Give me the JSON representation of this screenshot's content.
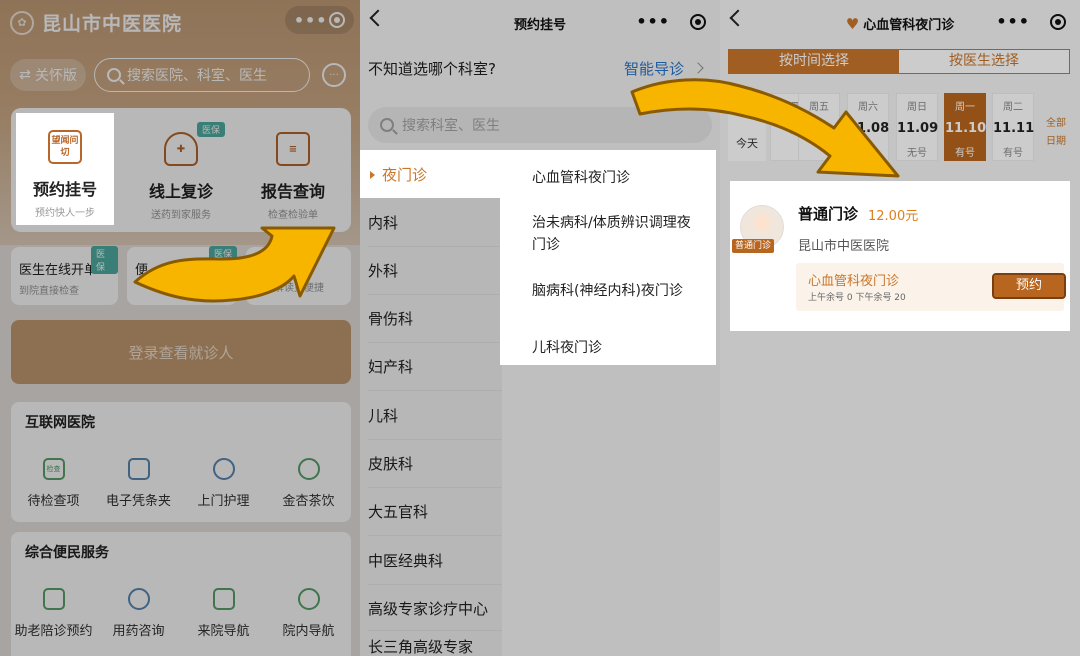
{
  "panel1": {
    "app_title": "昆山市中医医院",
    "care_mode": "关怀版",
    "search_placeholder": "搜索医院、科室、医生",
    "services": [
      {
        "name": "预约挂号",
        "sub": "预约快人一步",
        "icon_text": "望闻问切"
      },
      {
        "name": "线上复诊",
        "sub": "送药到家服务",
        "badge": "医保"
      },
      {
        "name": "报告查询",
        "sub": "检查检验单"
      }
    ],
    "row2": [
      {
        "title": "医生在线开单",
        "sub": "到院直接检查",
        "badge": "医保"
      },
      {
        "title": "便",
        "sub": "",
        "badge": "医保"
      },
      {
        "title": "",
        "sub": "报告解读更便捷"
      }
    ],
    "login_label": "登录查看就诊人",
    "internet_hospital": {
      "heading": "互联网医院",
      "items": [
        "待检查项",
        "电子凭条夹",
        "上门护理",
        "金杏茶饮"
      ],
      "check_icon_text": "检查"
    },
    "convenience": {
      "heading": "综合便民服务",
      "items": [
        "助老陪诊预约",
        "用药咨询",
        "来院导航",
        "院内导航"
      ]
    }
  },
  "panel2": {
    "nav_title": "预约挂号",
    "question": "不知道选哪个科室?",
    "smart_guide": "智能导诊",
    "search_placeholder": "搜索科室、医生",
    "departments": [
      "夜门诊",
      "内科",
      "外科",
      "骨伤科",
      "妇产科",
      "儿科",
      "皮肤科",
      "大五官科",
      "中医经典科",
      "高级专家诊疗中心",
      "长三角高级专家"
    ],
    "sub_departments": [
      "心血管科夜门诊",
      "治未病科/体质辨识调理夜门诊",
      "脑病科(神经内科)夜门诊",
      "儿科夜门诊"
    ]
  },
  "panel3": {
    "nav_title": "心血管科夜门诊",
    "tab_time": "按时间选择",
    "tab_doctor": "按医生选择",
    "today": "今天",
    "dates": [
      {
        "week": "周四",
        "day": "",
        "status": "号"
      },
      {
        "week": "周五",
        "day": "",
        "status": ""
      },
      {
        "week": "周六",
        "day": "11.08",
        "status": ""
      },
      {
        "week": "周日",
        "day": "11.09",
        "status": "无号"
      },
      {
        "week": "周一",
        "day": "11.10",
        "status": "有号"
      },
      {
        "week": "周二",
        "day": "11.11",
        "status": "有号"
      }
    ],
    "all_dates": "全部日期",
    "clinic_type": "普通门诊",
    "price": "12.00元",
    "hospital": "昆山市中医医院",
    "avatar_badge": "普通门诊",
    "dept_name": "心血管科夜门诊",
    "quota": "上午余号 0 下午余号 20",
    "book_label": "预约"
  },
  "colors": {
    "accent": "#c8762b",
    "link": "#2b7bd0",
    "arrow": "#f7b500"
  }
}
